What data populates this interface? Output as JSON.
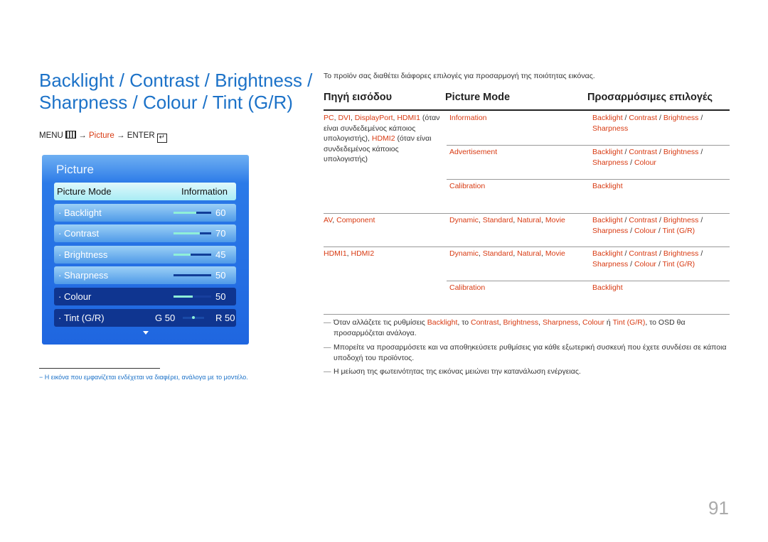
{
  "title": {
    "line1": "Backlight / Contrast / Brightness /",
    "line2": "Sharpness / Colour / Tint (G/R)"
  },
  "menu_path": {
    "menu": "MENU",
    "arrow1": "→",
    "picture": "Picture",
    "arrow2": "→",
    "enter": "ENTER",
    "menu_icon": "menu-grid-icon",
    "enter_icon": "enter-icon"
  },
  "osd": {
    "title": "Picture",
    "rows": [
      {
        "label": "Picture Mode",
        "value": "Information",
        "style": "sel"
      },
      {
        "label": "Backlight",
        "value": "60",
        "level": 60,
        "style": "light"
      },
      {
        "label": "Contrast",
        "value": "70",
        "level": 70,
        "style": "light"
      },
      {
        "label": "Brightness",
        "value": "45",
        "level": 45,
        "style": "light"
      },
      {
        "label": "Sharpness",
        "value": "50",
        "level": 0,
        "style": "light"
      },
      {
        "label": "Colour",
        "value": "50",
        "level": 50,
        "style": "dark"
      },
      {
        "label": "Tint (G/R)",
        "g": "G 50",
        "r": "R 50",
        "style": "dark"
      }
    ],
    "dot": "·",
    "more_icon": "triangle-down-icon"
  },
  "footnote": "−  Η εικόνα που εμφανίζεται ενδέχεται να διαφέρει, ανάλογα με το μοντέλο.",
  "intro": "Το προϊόν σας διαθέτει διάφορες επιλογές για προσαρμογή της ποιότητας εικόνας.",
  "table": {
    "headers": [
      "Πηγή εισόδου",
      "Picture Mode",
      "Προσαρμόσιμες επιλογές"
    ],
    "source1": [
      [
        "PC",
        1
      ],
      [
        ", ",
        0
      ],
      [
        "DVI",
        1
      ],
      [
        ", ",
        0
      ],
      [
        "DisplayPort",
        1
      ],
      [
        ", ",
        0
      ],
      [
        "HDMI1",
        1
      ],
      [
        " (όταν είναι συνδεδεμένος κάποιος υπολογιστής), ",
        0
      ],
      [
        "HDMI2",
        1
      ],
      [
        " (όταν είναι συνδεδεμένος κάποιος υπολογιστής)",
        0
      ]
    ],
    "modes1": [
      "Information",
      "Advertisement",
      "Calibration"
    ],
    "opts1": [
      [
        [
          "Backlight",
          1
        ],
        [
          " / ",
          0
        ],
        [
          "Contrast",
          1
        ],
        [
          " / ",
          0
        ],
        [
          "Brightness",
          1
        ],
        [
          " / ",
          0
        ],
        [
          "Sharpness",
          1
        ]
      ],
      [
        [
          "Backlight",
          1
        ],
        [
          " / ",
          0
        ],
        [
          "Contrast",
          1
        ],
        [
          " / ",
          0
        ],
        [
          "Brightness",
          1
        ],
        [
          " / ",
          0
        ],
        [
          "Sharpness",
          1
        ],
        [
          " / ",
          0
        ],
        [
          "Colour",
          1
        ]
      ],
      [
        [
          "Backlight",
          1
        ]
      ]
    ],
    "source2": [
      [
        "AV",
        1
      ],
      [
        ", ",
        0
      ],
      [
        "Component",
        1
      ]
    ],
    "modes2": [
      [
        "Dynamic",
        1
      ],
      [
        ", ",
        0
      ],
      [
        "Standard",
        1
      ],
      [
        ", ",
        0
      ],
      [
        "Natural",
        1
      ],
      [
        ", ",
        0
      ],
      [
        "Movie",
        1
      ]
    ],
    "opts2": [
      [
        "Backlight",
        1
      ],
      [
        " / ",
        0
      ],
      [
        "Contrast",
        1
      ],
      [
        " / ",
        0
      ],
      [
        "Brightness",
        1
      ],
      [
        " / ",
        0
      ],
      [
        "Sharpness",
        1
      ],
      [
        " / ",
        0
      ],
      [
        "Colour",
        1
      ],
      [
        " / ",
        0
      ],
      [
        "Tint (G/R)",
        1
      ]
    ],
    "source3": [
      [
        "HDMI1",
        1
      ],
      [
        ", ",
        0
      ],
      [
        "HDMI2",
        1
      ]
    ],
    "modes3a": [
      [
        "Dynamic",
        1
      ],
      [
        ", ",
        0
      ],
      [
        "Standard",
        1
      ],
      [
        ", ",
        0
      ],
      [
        "Natural",
        1
      ],
      [
        ", ",
        0
      ],
      [
        "Movie",
        1
      ]
    ],
    "opts3a": [
      [
        "Backlight",
        1
      ],
      [
        " / ",
        0
      ],
      [
        "Contrast",
        1
      ],
      [
        " / ",
        0
      ],
      [
        "Brightness",
        1
      ],
      [
        " / ",
        0
      ],
      [
        "Sharpness",
        1
      ],
      [
        " / ",
        0
      ],
      [
        "Colour",
        1
      ],
      [
        " / ",
        0
      ],
      [
        "Tint (G/R)",
        1
      ]
    ],
    "modes3b": "Calibration",
    "opts3b": "Backlight"
  },
  "notes": [
    [
      [
        "Όταν αλλάζετε τις ρυθμίσεις ",
        0
      ],
      [
        "Backlight",
        1
      ],
      [
        ", το ",
        0
      ],
      [
        "Contrast",
        1
      ],
      [
        ", ",
        0
      ],
      [
        "Brightness",
        1
      ],
      [
        ", ",
        0
      ],
      [
        "Sharpness",
        1
      ],
      [
        ", ",
        0
      ],
      [
        "Colour",
        1
      ],
      [
        "  ή ",
        0
      ],
      [
        "Tint (G/R)",
        1
      ],
      [
        ", το OSD θα προσαρμόζεται ανάλογα.",
        0
      ]
    ],
    [
      [
        "Μπορείτε να προσαρμόσετε και να αποθηκεύσετε ρυθμίσεις για κάθε εξωτερική συσκευή που έχετε συνδέσει σε κάποια υποδοχή του προϊόντος.",
        0
      ]
    ],
    [
      [
        "Η μείωση της φωτεινότητας της εικόνας μειώνει την κατανάλωση ενέργειας.",
        0
      ]
    ]
  ],
  "note_dash": "—",
  "page_number": "91",
  "colors": {
    "accent": "#d83a12",
    "title": "#1c72c8"
  }
}
